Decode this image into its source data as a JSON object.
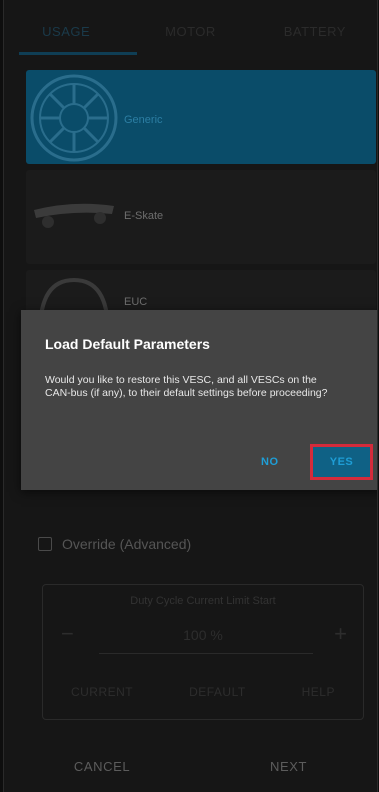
{
  "tabs": [
    {
      "label": "USAGE",
      "active": true
    },
    {
      "label": "MOTOR",
      "active": false
    },
    {
      "label": "BATTERY",
      "active": false
    }
  ],
  "usage_options": [
    {
      "label": "Generic",
      "selected": true,
      "icon": "motor-wheel-icon"
    },
    {
      "label": "E-Skate",
      "selected": false,
      "icon": "skateboard-icon"
    },
    {
      "label": "EUC",
      "selected": false,
      "icon": "unicycle-wheel-icon"
    }
  ],
  "override": {
    "label": "Override (Advanced)",
    "checked": false
  },
  "parameter": {
    "title": "Duty Cycle Current Limit Start",
    "value": "100 %",
    "minus": "−",
    "plus": "+",
    "actions": [
      "CURRENT",
      "DEFAULT",
      "HELP"
    ]
  },
  "footer": {
    "cancel": "CANCEL",
    "next": "NEXT"
  },
  "dialog": {
    "title": "Load Default Parameters",
    "message": "Would you like to restore this VESC, and all VESCs on the CAN-bus (if any), to their default settings before proceeding?",
    "no_label": "NO",
    "yes_label": "YES"
  },
  "colors": {
    "accent": "#1e9ed6",
    "highlight_border": "#d42b3b",
    "selected_card": "#0a4c69"
  }
}
